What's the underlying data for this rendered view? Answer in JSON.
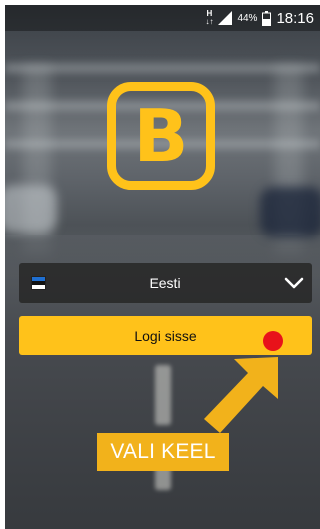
{
  "status_bar": {
    "network_top": "H",
    "network_bottom": "↓↑",
    "battery_percent": "44%",
    "time": "18:16"
  },
  "logo": {
    "letter": "B",
    "color": "#ffc21a"
  },
  "language_select": {
    "flag_icon": "estonia-flag-icon",
    "selected": "Eesti"
  },
  "login_button": {
    "label": "Logi sisse"
  },
  "annotation": {
    "callout_text": "VALI KEEL",
    "dot_color": "#e8121a",
    "callout_color": "#f2b21b"
  }
}
